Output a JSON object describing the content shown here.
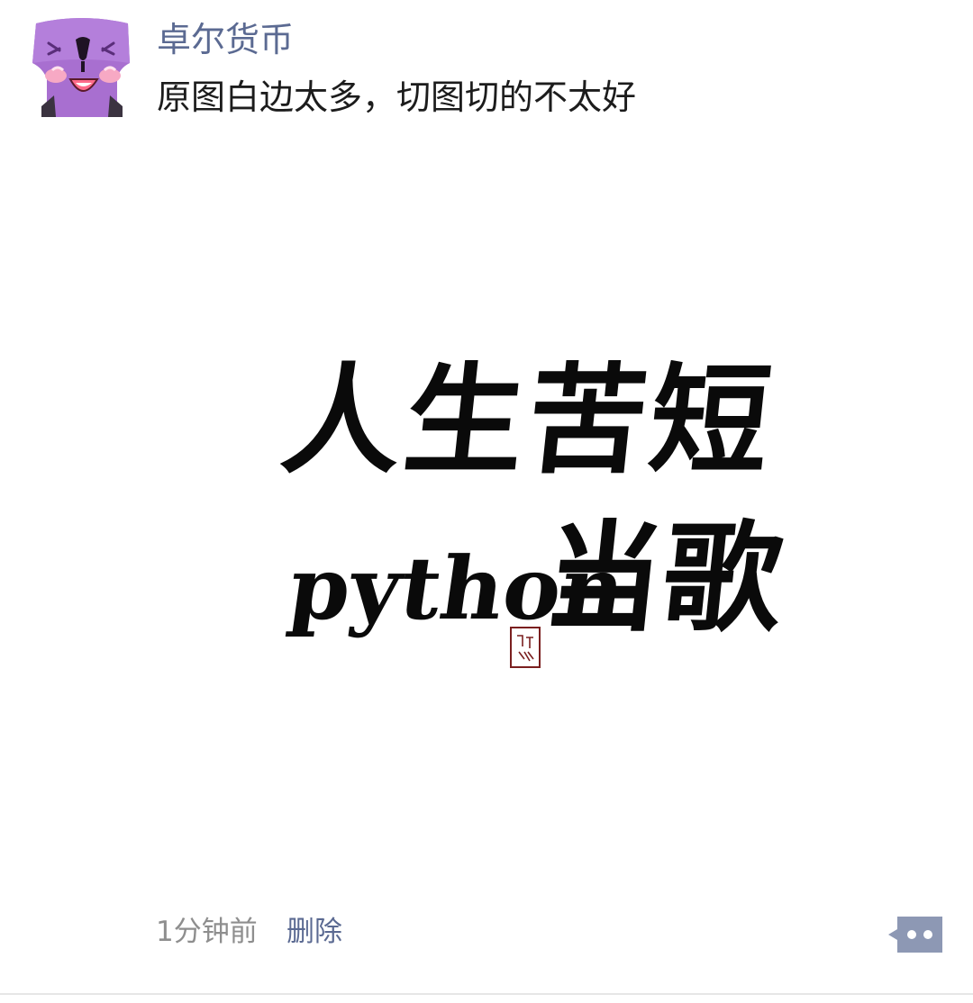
{
  "post": {
    "author": "卓尔货币",
    "text": "原图白边太多，切图切的不太好",
    "image": {
      "line1": "人生苦短",
      "line2_latin": "python",
      "line2_cjk": "当歌"
    },
    "time": "1分钟前",
    "delete_label": "删除"
  },
  "icons": {
    "avatar": "purple-cartoon-avatar",
    "more": "comment-more-icon"
  },
  "colors": {
    "author": "#5b6a92",
    "link": "#5b6a92",
    "time": "#8e8e8e",
    "more_button": "#8d98b4"
  }
}
